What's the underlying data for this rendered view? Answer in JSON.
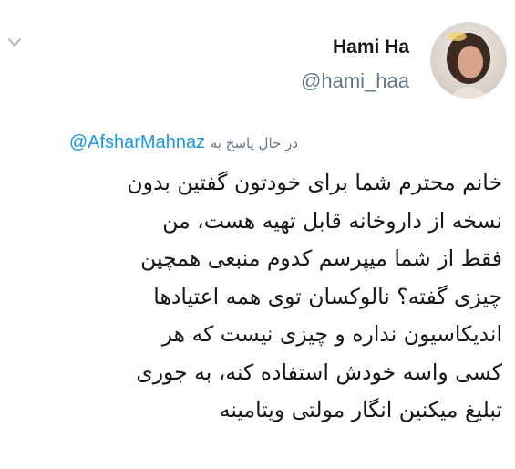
{
  "tweet": {
    "author": {
      "name": "Hami Ha",
      "handle": "@hami_haa",
      "avatar_icon": "profile-photo"
    },
    "menu_icon": "chevron-down-icon",
    "reply": {
      "label": "در حال پاسخ به",
      "mention": "@AfsharMahnaz"
    },
    "text_lines": [
      "خانم محترم شما برای خودتون گفتین بدون",
      "نسخه از داروخانه قابل تهیه هست، من",
      "فقط از شما میپرسم کدوم منبعی همچین",
      "چیزی گفته؟ نالوکسان توی همه اعتیادها",
      "اندیکاسیون نداره و چیزی نیست که هر",
      "کسی واسه خودش استفاده کنه، به جوری",
      "تبلیغ میکنین انگار مولتی ویتامینه"
    ]
  },
  "colors": {
    "name": "#14171a",
    "secondary": "#657786",
    "link": "#1b95e0"
  }
}
